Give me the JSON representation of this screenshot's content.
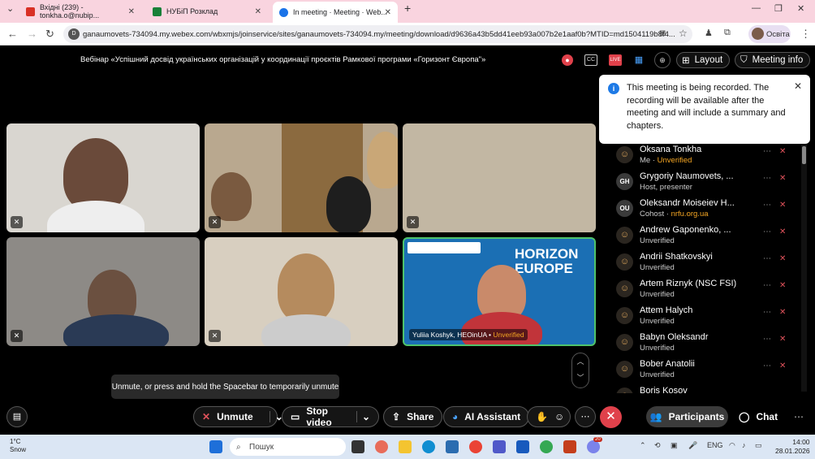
{
  "browser": {
    "tabs": [
      {
        "label": "Вхідні (239) - tonkha.o@nubip...",
        "color": "#d93025"
      },
      {
        "label": "НУБіП Розклад",
        "color": "#188038"
      },
      {
        "label": "In meeting · Meeting · Web...",
        "color": "#1a73e8"
      }
    ],
    "url": "ganaumovets-734094.my.webex.com/wbxmjs/joinservice/sites/ganaumovets-734094.my/meeting/download/d9636a43b5dd41eeb93a007b2e1aaf0b?MTID=md1504119b8f4...",
    "profile": "Освіта"
  },
  "meeting": {
    "title": "Вебінар «Успішний досвід українських організацій у координації проєктів Рамкової програми «Горизонт Європа\"»",
    "layout_label": "Layout",
    "info_label": "Meeting info",
    "notification": "This meeting is being recorded. The recording will be available after the meeting and will include a summary and chapters.",
    "tiles": [
      {
        "bg": "#d9d6d0"
      },
      {
        "bg": "#b9a88f"
      },
      {
        "bg": "#c2b7a3"
      },
      {
        "bg": "#8d8a86"
      },
      {
        "bg": "#d8cfc0"
      },
      {
        "bg": "#1b6fb4"
      }
    ],
    "speaker": {
      "name": "Yuliia Koshyk, HEOinUA",
      "status": "Unverified"
    },
    "horizon_text": "HORIZON EUROPE",
    "tooltip": "Unmute, or press and hold the Spacebar to temporarily unmute",
    "controls": {
      "unmute": "Unmute",
      "stop_video": "Stop video",
      "share": "Share",
      "ai": "AI Assistant",
      "participants": "Participants",
      "chat": "Chat"
    }
  },
  "participants": [
    {
      "name": "Oksana Tonkha",
      "sub": "Me",
      "status": "Unverified",
      "avatar": "☺",
      "initials": ""
    },
    {
      "name": "Grygoriy Naumovets, ...",
      "sub": "Host, presenter",
      "status": "",
      "avatar": "",
      "initials": "GH"
    },
    {
      "name": "Oleksandr Moiseiev H...",
      "sub": "Cohost",
      "status": "nrfu.org.ua",
      "avatar": "",
      "initials": "OU"
    },
    {
      "name": "Andrew Gaponenko, ...",
      "sub": "",
      "status": "Unverified",
      "avatar": "☺",
      "initials": ""
    },
    {
      "name": "Andrii Shatkovskyi",
      "sub": "",
      "status": "Unverified",
      "avatar": "☺",
      "initials": ""
    },
    {
      "name": "Artem Riznyk (NSC FSI)",
      "sub": "",
      "status": "Unverified",
      "avatar": "☺",
      "initials": ""
    },
    {
      "name": "Attem Halych",
      "sub": "",
      "status": "Unverified",
      "avatar": "☺",
      "initials": ""
    },
    {
      "name": "Babyn Oleksandr",
      "sub": "",
      "status": "Unverified",
      "avatar": "☺",
      "initials": ""
    },
    {
      "name": "Bober Anatolii",
      "sub": "",
      "status": "Unverified",
      "avatar": "☺",
      "initials": ""
    },
    {
      "name": "Boris Kosov",
      "sub": "",
      "status": "",
      "avatar": "☺",
      "initials": ""
    }
  ],
  "taskbar": {
    "temp": "1°C",
    "weather": "Snow",
    "search": "Пошук",
    "lang": "ENG",
    "time": "14:00",
    "date": "28.01.2026",
    "badge": "20"
  }
}
